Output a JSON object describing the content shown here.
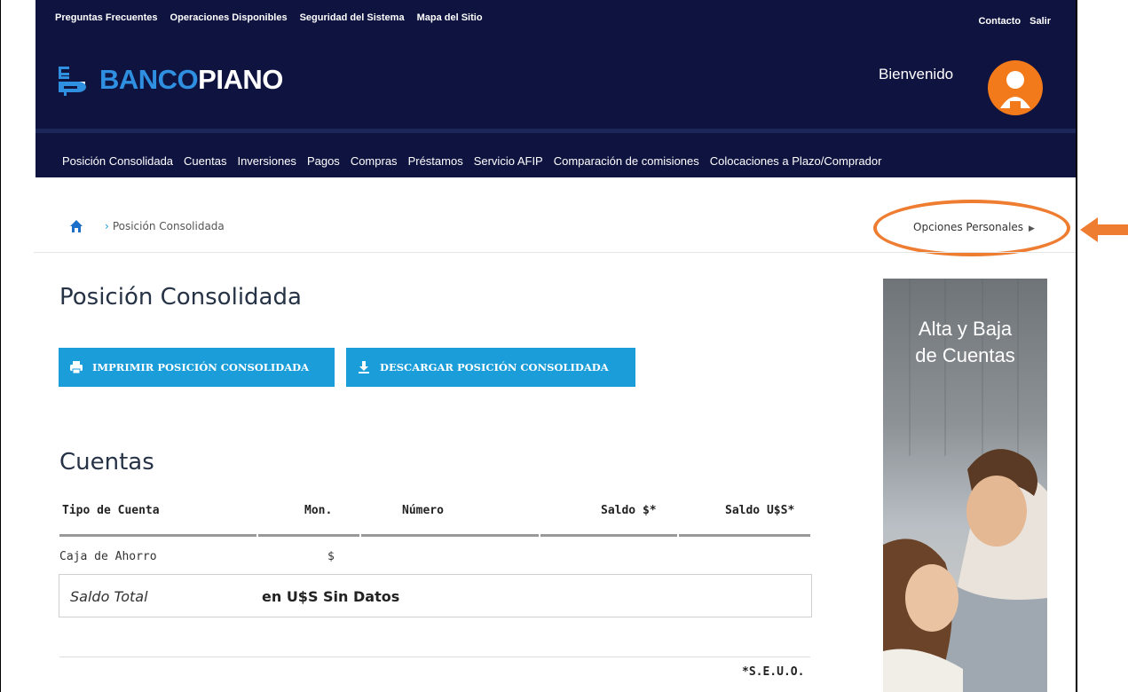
{
  "header": {
    "top_links": [
      "Preguntas Frecuentes",
      "Operaciones Disponibles",
      "Seguridad del Sistema",
      "Mapa del Sitio"
    ],
    "util_links": [
      "Contacto",
      "Salir"
    ],
    "brand": {
      "part1": "BANCO",
      "part2": "PIANO"
    },
    "welcome": "Bienvenido"
  },
  "nav": {
    "items": [
      "Posición Consolidada",
      "Cuentas",
      "Inversiones",
      "Pagos",
      "Compras",
      "Préstamos",
      "Servicio AFIP",
      "Comparación de comisiones",
      "Colocaciones a Plazo/Comprador"
    ]
  },
  "breadcrumb": {
    "separator": "›",
    "current": "Posición Consolidada"
  },
  "personal_options": {
    "label": "Opciones Personales",
    "arrow": "▶"
  },
  "page": {
    "title": "Posición Consolidada",
    "print_button": "IMPRIMIR POSICIÓN CONSOLIDADA",
    "download_button": "DESCARGAR POSICIÓN CONSOLIDADA"
  },
  "accounts": {
    "title": "Cuentas",
    "columns": [
      "Tipo de Cuenta",
      "Mon.",
      "Número",
      "Saldo $*",
      "Saldo U$S*"
    ],
    "rows": [
      {
        "type": "Caja de Ahorro",
        "currency": "$",
        "number": "",
        "balance_ars": "",
        "balance_usd": ""
      }
    ],
    "total_label": "Saldo Total",
    "total_value": "en U$S Sin Datos",
    "footnote": "*S.E.U.O."
  },
  "banner": {
    "line1": "Alta y Baja",
    "line2": "de Cuentas"
  },
  "colors": {
    "navy": "#0f1340",
    "accent_blue": "#1b9dd9",
    "avatar_orange": "#f27a1a",
    "highlight_orange": "#ee7d31"
  }
}
